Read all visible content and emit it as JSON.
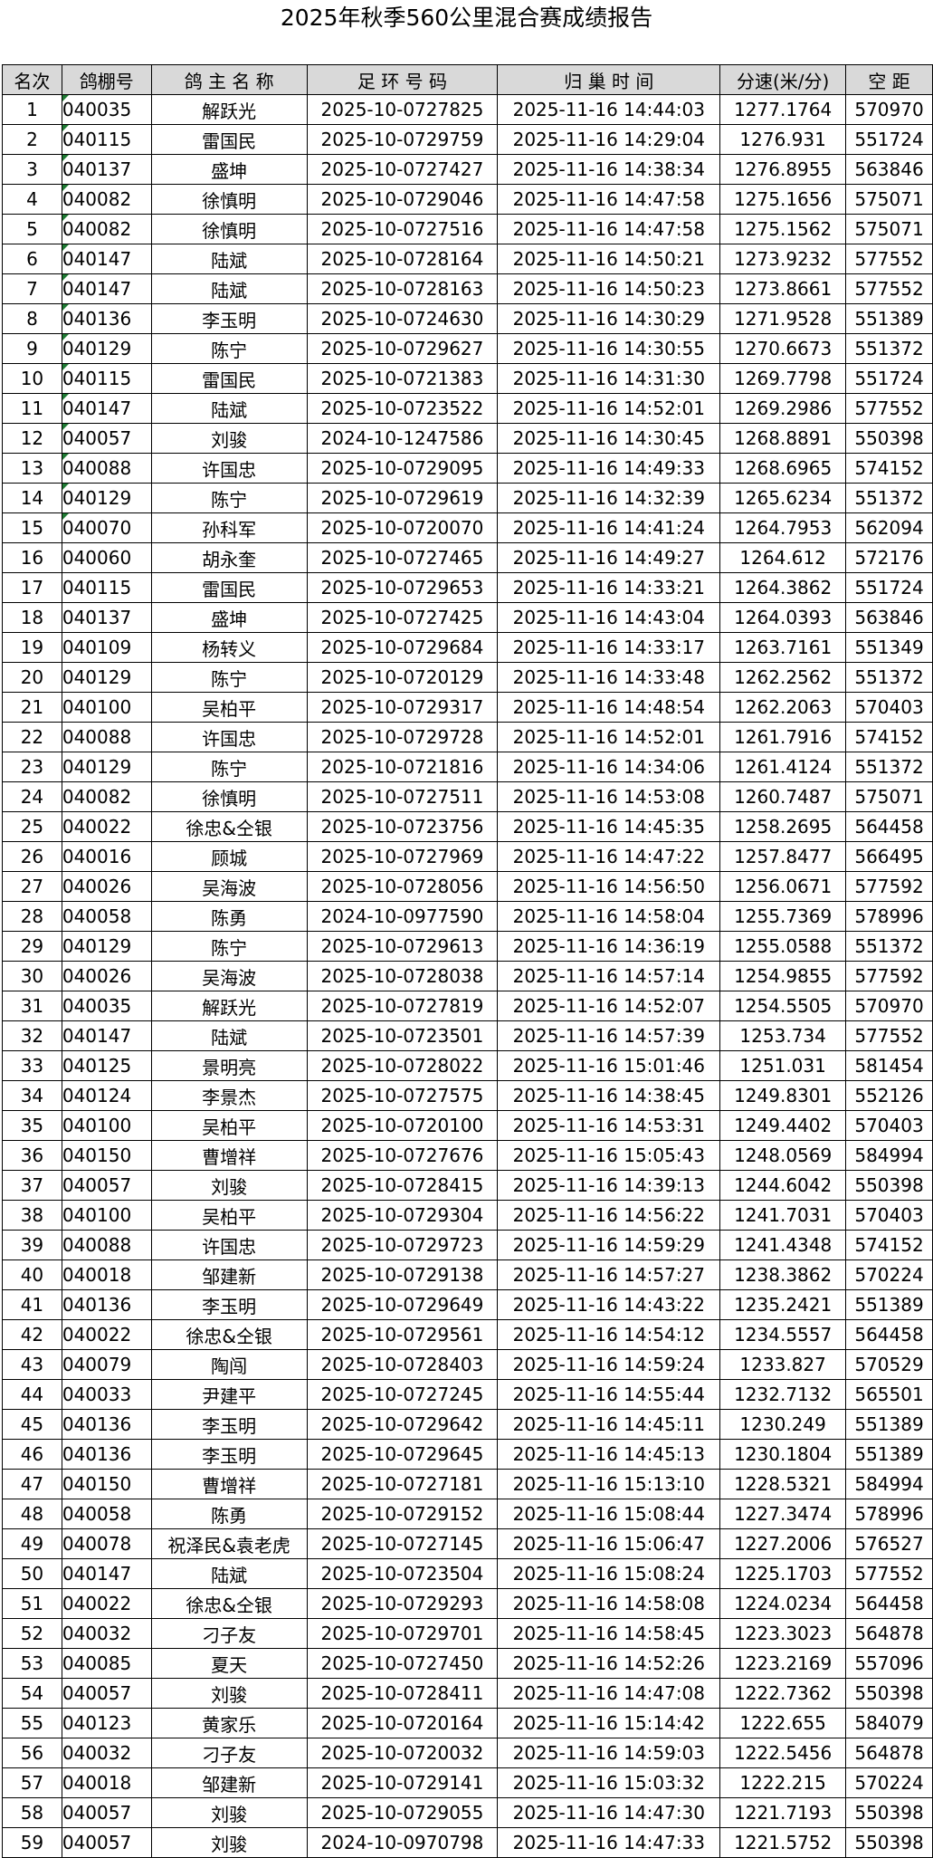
{
  "title": "2025年秋季560公里混合赛成绩报告",
  "table": {
    "headers": [
      "名次",
      "鸽棚号",
      "鸽 主 名 称",
      "足 环 号 码",
      "归   巢   时   间",
      "分速(米/分)",
      "空  距"
    ],
    "rows": [
      [
        "1",
        "040035",
        "解跃光",
        "2025-10-0727825",
        "2025-11-16 14:44:03",
        "1277.1764",
        "570970"
      ],
      [
        "2",
        "040115",
        "雷国民",
        "2025-10-0729759",
        "2025-11-16 14:29:04",
        "1276.931",
        "551724"
      ],
      [
        "3",
        "040137",
        "盛坤",
        "2025-10-0727427",
        "2025-11-16 14:38:34",
        "1276.8955",
        "563846"
      ],
      [
        "4",
        "040082",
        "徐慎明",
        "2025-10-0729046",
        "2025-11-16 14:47:58",
        "1275.1656",
        "575071"
      ],
      [
        "5",
        "040082",
        "徐慎明",
        "2025-10-0727516",
        "2025-11-16 14:47:58",
        "1275.1562",
        "575071"
      ],
      [
        "6",
        "040147",
        "陆斌",
        "2025-10-0728164",
        "2025-11-16 14:50:21",
        "1273.9232",
        "577552"
      ],
      [
        "7",
        "040147",
        "陆斌",
        "2025-10-0728163",
        "2025-11-16 14:50:23",
        "1273.8661",
        "577552"
      ],
      [
        "8",
        "040136",
        "李玉明",
        "2025-10-0724630",
        "2025-11-16 14:30:29",
        "1271.9528",
        "551389"
      ],
      [
        "9",
        "040129",
        "陈宁",
        "2025-10-0729627",
        "2025-11-16 14:30:55",
        "1270.6673",
        "551372"
      ],
      [
        "10",
        "040115",
        "雷国民",
        "2025-10-0721383",
        "2025-11-16 14:31:30",
        "1269.7798",
        "551724"
      ],
      [
        "11",
        "040147",
        "陆斌",
        "2025-10-0723522",
        "2025-11-16 14:52:01",
        "1269.2986",
        "577552"
      ],
      [
        "12",
        "040057",
        "刘骏",
        "2024-10-1247586",
        "2025-11-16 14:30:45",
        "1268.8891",
        "550398"
      ],
      [
        "13",
        "040088",
        "许国忠",
        "2025-10-0729095",
        "2025-11-16 14:49:33",
        "1268.6965",
        "574152"
      ],
      [
        "14",
        "040129",
        "陈宁",
        "2025-10-0729619",
        "2025-11-16 14:32:39",
        "1265.6234",
        "551372"
      ],
      [
        "15",
        "040070",
        "孙科军",
        "2025-10-0720070",
        "2025-11-16 14:41:24",
        "1264.7953",
        "562094"
      ],
      [
        "16",
        "040060",
        "胡永奎",
        "2025-10-0727465",
        "2025-11-16 14:49:27",
        "1264.612",
        "572176"
      ],
      [
        "17",
        "040115",
        "雷国民",
        "2025-10-0729653",
        "2025-11-16 14:33:21",
        "1264.3862",
        "551724"
      ],
      [
        "18",
        "040137",
        "盛坤",
        "2025-10-0727425",
        "2025-11-16 14:43:04",
        "1264.0393",
        "563846"
      ],
      [
        "19",
        "040109",
        "杨转义",
        "2025-10-0729684",
        "2025-11-16 14:33:17",
        "1263.7161",
        "551349"
      ],
      [
        "20",
        "040129",
        "陈宁",
        "2025-10-0720129",
        "2025-11-16 14:33:48",
        "1262.2562",
        "551372"
      ],
      [
        "21",
        "040100",
        "吴柏平",
        "2025-10-0729317",
        "2025-11-16 14:48:54",
        "1262.2063",
        "570403"
      ],
      [
        "22",
        "040088",
        "许国忠",
        "2025-10-0729728",
        "2025-11-16 14:52:01",
        "1261.7916",
        "574152"
      ],
      [
        "23",
        "040129",
        "陈宁",
        "2025-10-0721816",
        "2025-11-16 14:34:06",
        "1261.4124",
        "551372"
      ],
      [
        "24",
        "040082",
        "徐慎明",
        "2025-10-0727511",
        "2025-11-16 14:53:08",
        "1260.7487",
        "575071"
      ],
      [
        "25",
        "040022",
        "徐忠&仝银",
        "2025-10-0723756",
        "2025-11-16 14:45:35",
        "1258.2695",
        "564458"
      ],
      [
        "26",
        "040016",
        "顾城",
        "2025-10-0727969",
        "2025-11-16 14:47:22",
        "1257.8477",
        "566495"
      ],
      [
        "27",
        "040026",
        "吴海波",
        "2025-10-0728056",
        "2025-11-16 14:56:50",
        "1256.0671",
        "577592"
      ],
      [
        "28",
        "040058",
        "陈勇",
        "2024-10-0977590",
        "2025-11-16 14:58:04",
        "1255.7369",
        "578996"
      ],
      [
        "29",
        "040129",
        "陈宁",
        "2025-10-0729613",
        "2025-11-16 14:36:19",
        "1255.0588",
        "551372"
      ],
      [
        "30",
        "040026",
        "吴海波",
        "2025-10-0728038",
        "2025-11-16 14:57:14",
        "1254.9855",
        "577592"
      ],
      [
        "31",
        "040035",
        "解跃光",
        "2025-10-0727819",
        "2025-11-16 14:52:07",
        "1254.5505",
        "570970"
      ],
      [
        "32",
        "040147",
        "陆斌",
        "2025-10-0723501",
        "2025-11-16 14:57:39",
        "1253.734",
        "577552"
      ],
      [
        "33",
        "040125",
        "景明亮",
        "2025-10-0728022",
        "2025-11-16 15:01:46",
        "1251.031",
        "581454"
      ],
      [
        "34",
        "040124",
        "李景杰",
        "2025-10-0727575",
        "2025-11-16 14:38:45",
        "1249.8301",
        "552126"
      ],
      [
        "35",
        "040100",
        "吴柏平",
        "2025-10-0720100",
        "2025-11-16 14:53:31",
        "1249.4402",
        "570403"
      ],
      [
        "36",
        "040150",
        "曹增祥",
        "2025-10-0727676",
        "2025-11-16 15:05:43",
        "1248.0569",
        "584994"
      ],
      [
        "37",
        "040057",
        "刘骏",
        "2025-10-0728415",
        "2025-11-16 14:39:13",
        "1244.6042",
        "550398"
      ],
      [
        "38",
        "040100",
        "吴柏平",
        "2025-10-0729304",
        "2025-11-16 14:56:22",
        "1241.7031",
        "570403"
      ],
      [
        "39",
        "040088",
        "许国忠",
        "2025-10-0729723",
        "2025-11-16 14:59:29",
        "1241.4348",
        "574152"
      ],
      [
        "40",
        "040018",
        "邹建新",
        "2025-10-0729138",
        "2025-11-16 14:57:27",
        "1238.3862",
        "570224"
      ],
      [
        "41",
        "040136",
        "李玉明",
        "2025-10-0729649",
        "2025-11-16 14:43:22",
        "1235.2421",
        "551389"
      ],
      [
        "42",
        "040022",
        "徐忠&仝银",
        "2025-10-0729561",
        "2025-11-16 14:54:12",
        "1234.5557",
        "564458"
      ],
      [
        "43",
        "040079",
        "陶闯",
        "2025-10-0728403",
        "2025-11-16 14:59:24",
        "1233.827",
        "570529"
      ],
      [
        "44",
        "040033",
        "尹建平",
        "2025-10-0727245",
        "2025-11-16 14:55:44",
        "1232.7132",
        "565501"
      ],
      [
        "45",
        "040136",
        "李玉明",
        "2025-10-0729642",
        "2025-11-16 14:45:11",
        "1230.249",
        "551389"
      ],
      [
        "46",
        "040136",
        "李玉明",
        "2025-10-0729645",
        "2025-11-16 14:45:13",
        "1230.1804",
        "551389"
      ],
      [
        "47",
        "040150",
        "曹增祥",
        "2025-10-0727181",
        "2025-11-16 15:13:10",
        "1228.5321",
        "584994"
      ],
      [
        "48",
        "040058",
        "陈勇",
        "2025-10-0729152",
        "2025-11-16 15:08:44",
        "1227.3474",
        "578996"
      ],
      [
        "49",
        "040078",
        "祝泽民&袁老虎",
        "2025-10-0727145",
        "2025-11-16 15:06:47",
        "1227.2006",
        "576527"
      ],
      [
        "50",
        "040147",
        "陆斌",
        "2025-10-0723504",
        "2025-11-16 15:08:24",
        "1225.1703",
        "577552"
      ],
      [
        "51",
        "040022",
        "徐忠&仝银",
        "2025-10-0729293",
        "2025-11-16 14:58:08",
        "1224.0234",
        "564458"
      ],
      [
        "52",
        "040032",
        "刁子友",
        "2025-10-0729701",
        "2025-11-16 14:58:45",
        "1223.3023",
        "564878"
      ],
      [
        "53",
        "040085",
        "夏天",
        "2025-10-0727450",
        "2025-11-16 14:52:26",
        "1223.2169",
        "557096"
      ],
      [
        "54",
        "040057",
        "刘骏",
        "2025-10-0728411",
        "2025-11-16 14:47:08",
        "1222.7362",
        "550398"
      ],
      [
        "55",
        "040123",
        "黄家乐",
        "2025-10-0720164",
        "2025-11-16 15:14:42",
        "1222.655",
        "584079"
      ],
      [
        "56",
        "040032",
        "刁子友",
        "2025-10-0720032",
        "2025-11-16 14:59:03",
        "1222.5456",
        "564878"
      ],
      [
        "57",
        "040018",
        "邹建新",
        "2025-10-0729141",
        "2025-11-16 15:03:32",
        "1222.215",
        "570224"
      ],
      [
        "58",
        "040057",
        "刘骏",
        "2025-10-0729055",
        "2025-11-16 14:47:30",
        "1221.7193",
        "550398"
      ],
      [
        "59",
        "040057",
        "刘骏",
        "2024-10-0970798",
        "2025-11-16 14:47:33",
        "1221.5752",
        "550398"
      ]
    ]
  }
}
